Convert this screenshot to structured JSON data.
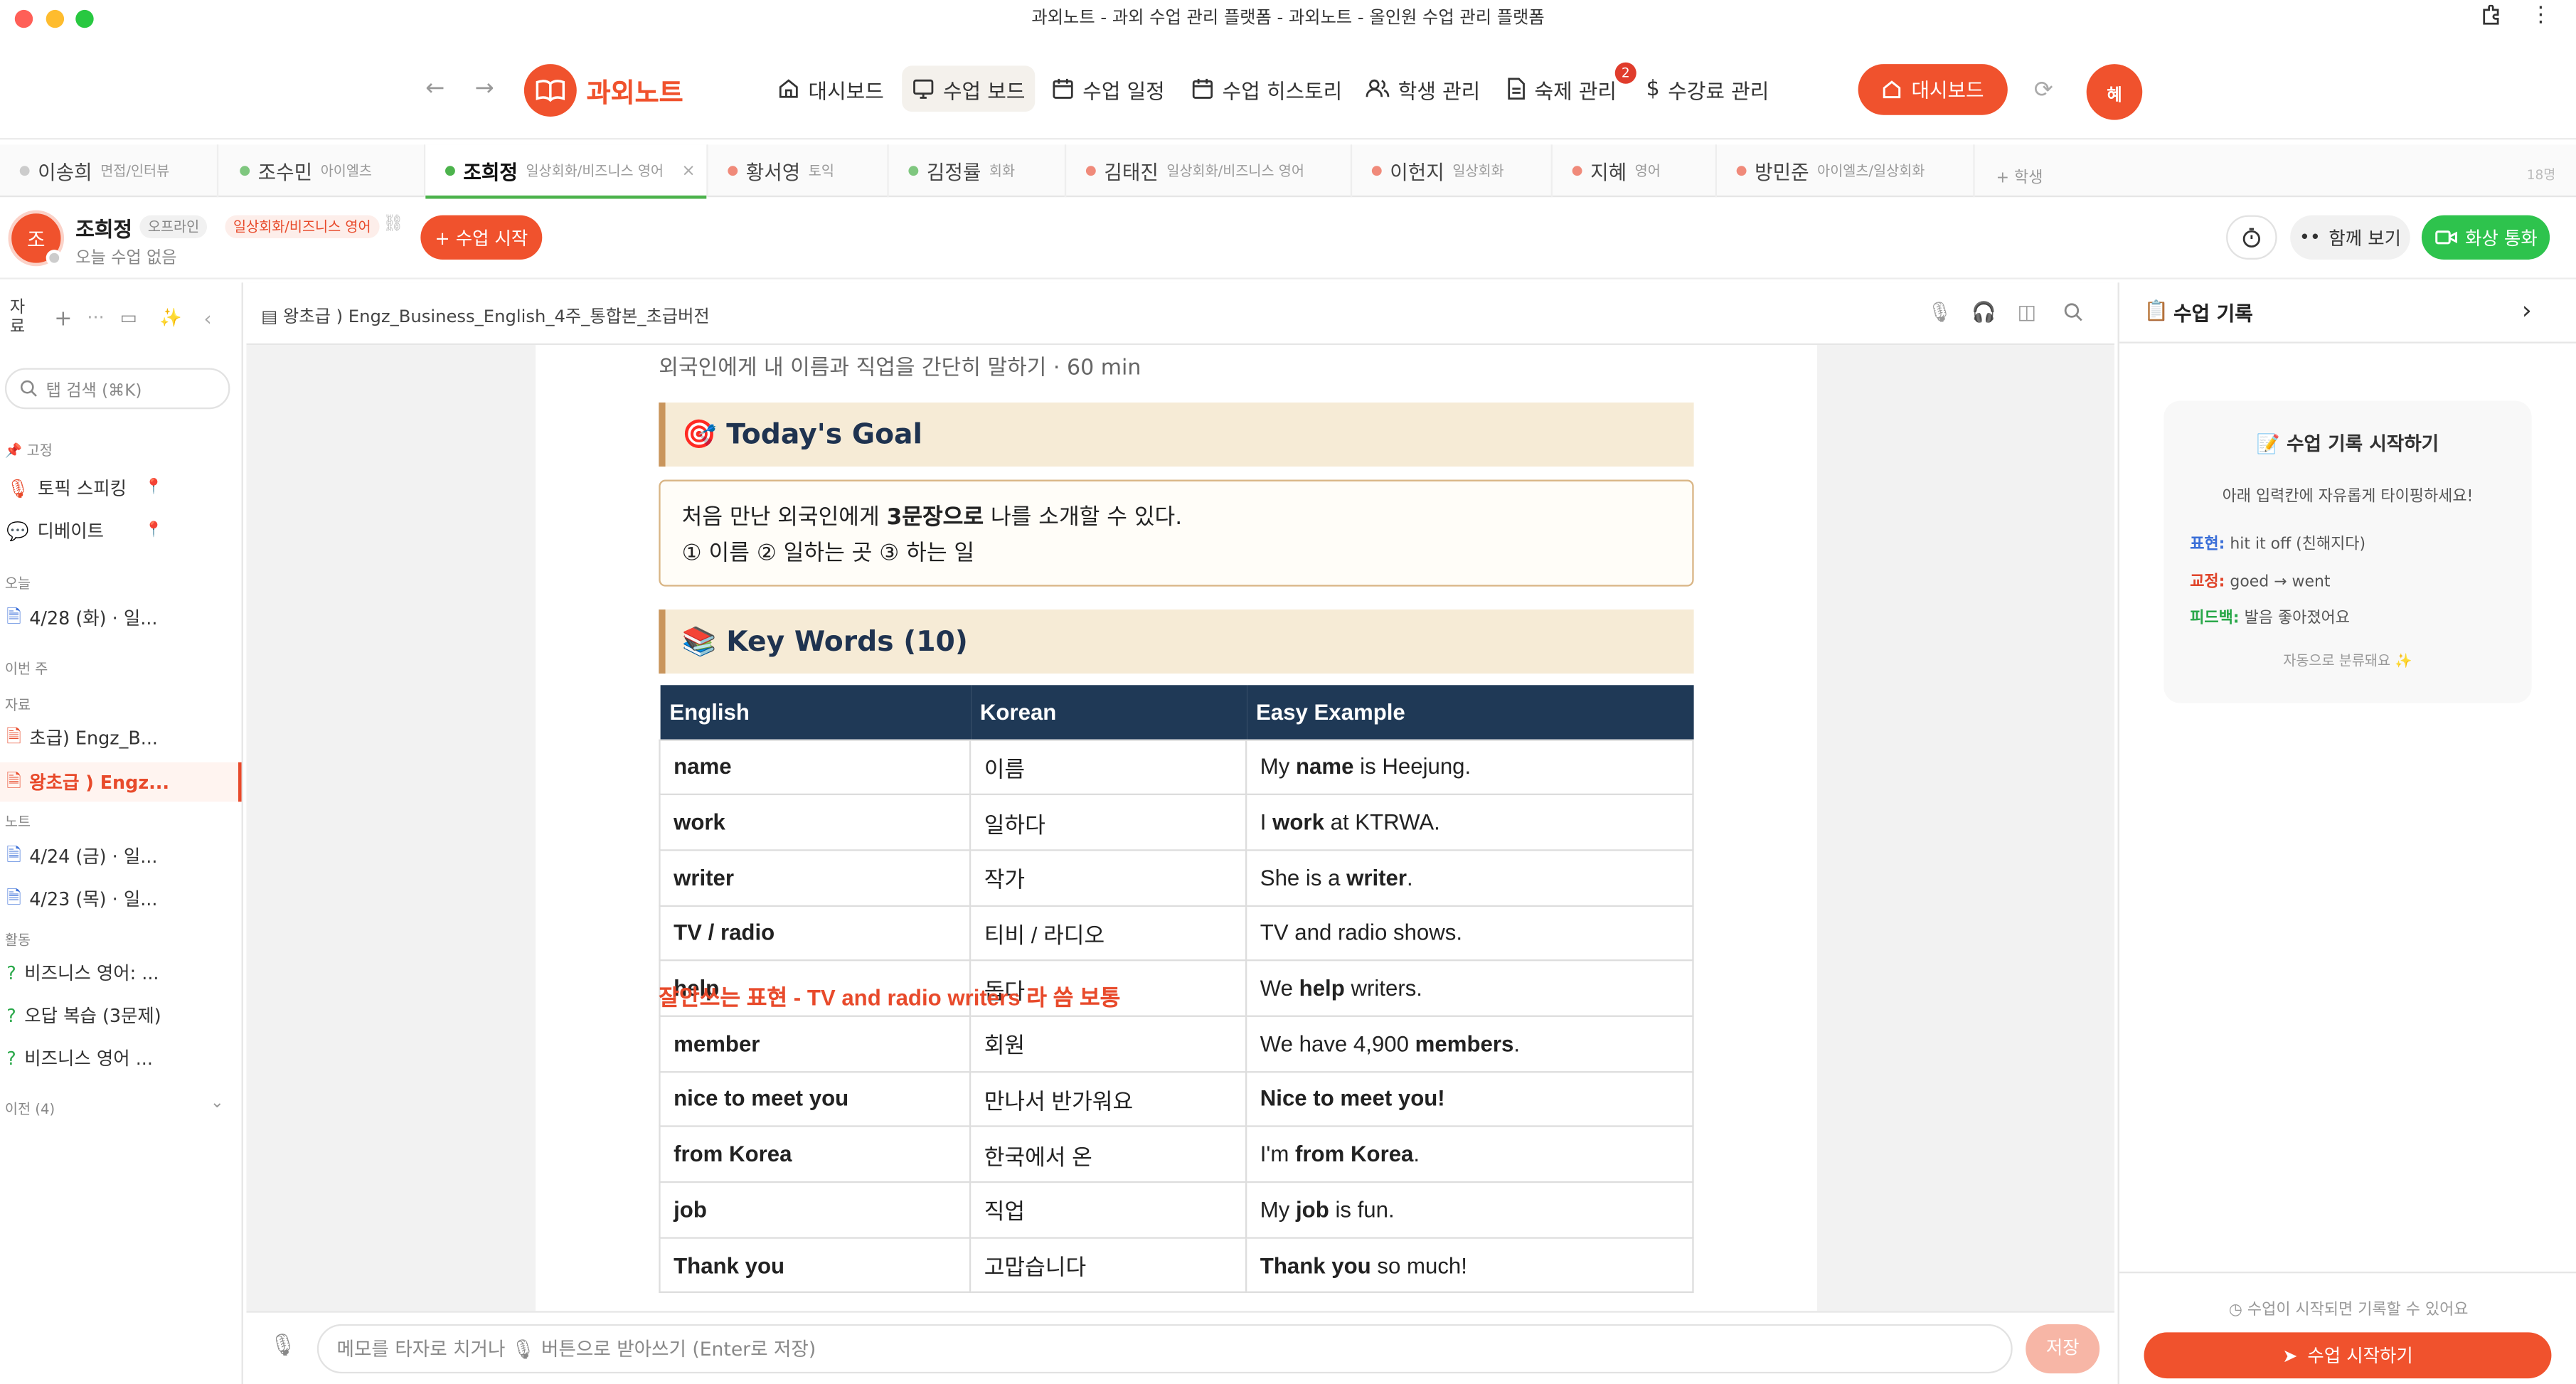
{
  "window": {
    "title": "과외노트 - 과외 수업 관리 플랫폼 - 과외노트 - 올인원 수업 관리 플랫폼"
  },
  "header": {
    "logo": "과외노트",
    "nav": [
      {
        "label": "대시보드",
        "icon": "home-icon"
      },
      {
        "label": "수업 보드",
        "icon": "monitor-icon"
      },
      {
        "label": "수업 일정",
        "icon": "calendar-icon"
      },
      {
        "label": "수업 히스토리",
        "icon": "calendar-icon"
      },
      {
        "label": "학생 관리",
        "icon": "users-icon"
      },
      {
        "label": "숙제 관리",
        "icon": "document-icon",
        "badge": "2"
      },
      {
        "label": "수강료 관리",
        "icon": "dollar-icon"
      }
    ],
    "dashboard_button": "대시보드",
    "avatar": "혜"
  },
  "student_tabs": [
    {
      "name": "이송희",
      "subject": "면접/인터뷰"
    },
    {
      "name": "조수민",
      "subject": "아이엘츠"
    },
    {
      "name": "조희정",
      "subject": "일상회화/비즈니스 영어"
    },
    {
      "name": "황서영",
      "subject": "토익"
    },
    {
      "name": "김정률",
      "subject": "회화"
    },
    {
      "name": "김태진",
      "subject": "일상회화/비즈니스 영어"
    },
    {
      "name": "이헌지",
      "subject": "일상회화"
    },
    {
      "name": "지혜",
      "subject": "영어"
    },
    {
      "name": "방민준",
      "subject": "아이엘츠/일상회화"
    }
  ],
  "add_student": "+ 학생",
  "tab_count": "18명",
  "student_bar": {
    "avatar": "조",
    "name": "조희정",
    "status": "오프라인",
    "subject": "일상회화/비즈니스 영어",
    "today": "오늘 수업 없음",
    "start_button": "+ 수업 시작",
    "watch_together": "함께 보기",
    "video_call": "화상 통화"
  },
  "sidebar": {
    "title": "자료",
    "search_placeholder": "탭 검색 (⌘K)",
    "pinned_label": "고정",
    "pinned": [
      "토픽 스피킹",
      "디베이트"
    ],
    "today_label": "오늘",
    "today": [
      "4/28 (화) · 일..."
    ],
    "week_label": "이번 주",
    "materials_label": "자료",
    "materials": [
      "초급) Engz_B...",
      "왕초급 ) Engz..."
    ],
    "notes_label": "노트",
    "notes": [
      "4/24 (금) · 일...",
      "4/23 (목) · 일..."
    ],
    "activity_label": "활동",
    "activities": [
      "비즈니스 영어: ...",
      "오답 복습 (3문제)",
      "비즈니스 영어 ..."
    ],
    "previous": "이전 (4)"
  },
  "document": {
    "filename": "왕초급 ) Engz_Business_English_4주_통합본_초급버전",
    "subtitle": "외국인에게 내 이름과 직업을 간단히 말하기 · 60 min",
    "goal_heading": "🎯 Today's Goal",
    "goal_line1_a": "처음 만난 외국인에게 ",
    "goal_line1_b": "3문장으로",
    "goal_line1_c": " 나를 소개할 수 있다.",
    "goal_line2": "① 이름 ② 일하는 곳 ③ 하는 일",
    "keywords_heading": "📚 Key Words (10)",
    "table_headers": [
      "English",
      "Korean",
      "Easy Example"
    ],
    "rows": [
      {
        "en": "name",
        "ko": "이름",
        "ex_a": "My ",
        "ex_b": "name",
        "ex_c": " is Heejung."
      },
      {
        "en": "work",
        "ko": "일하다",
        "ex_a": "I ",
        "ex_b": "work",
        "ex_c": " at KTRWA."
      },
      {
        "en": "writer",
        "ko": "작가",
        "ex_a": "She is a ",
        "ex_b": "writer",
        "ex_c": "."
      },
      {
        "en": "TV / radio",
        "ko": "티비 / 라디오",
        "ex_a": "TV and radio shows.",
        "ex_b": "",
        "ex_c": ""
      },
      {
        "en": "help",
        "ko": "돕다",
        "ex_a": "We ",
        "ex_b": "help",
        "ex_c": " writers."
      },
      {
        "en": "member",
        "ko": "회원",
        "ex_a": "We have 4,900 ",
        "ex_b": "members",
        "ex_c": "."
      },
      {
        "en": "nice to meet you",
        "ko": "만나서 반가워요",
        "ex_a": "",
        "ex_b": "Nice to meet you!",
        "ex_c": ""
      },
      {
        "en": "from Korea",
        "ko": "한국에서 온",
        "ex_a": "I'm ",
        "ex_b": "from Korea",
        "ex_c": "."
      },
      {
        "en": "job",
        "ko": "직업",
        "ex_a": "My ",
        "ex_b": "job",
        "ex_c": " is fun."
      },
      {
        "en": "Thank you",
        "ko": "고맙습니다",
        "ex_a": "",
        "ex_b": "Thank you",
        "ex_c": " so much!"
      }
    ],
    "annotation": "잘안쓰는 표현 - TV and radio writers 라 씀 보통"
  },
  "memo": {
    "placeholder": "메모를 타자로 치거나 🎙 버튼으로 받아쓰기 (Enter로 저장)",
    "save": "저장"
  },
  "right_panel": {
    "title": "수업 기록",
    "card_title": "📝 수업 기록 시작하기",
    "card_desc": "아래 입력칸에 자유롭게 타이핑하세요!",
    "examples": [
      {
        "label": "표현:",
        "text": "hit it off (친해지다)",
        "color": "#3b6fd8"
      },
      {
        "label": "교정:",
        "text": "goed → went",
        "color": "#e0462c"
      },
      {
        "label": "피드백:",
        "text": "발음 좋아졌어요",
        "color": "#2aa84a"
      }
    ],
    "auto": "자동으로 분류돼요 ✨",
    "hint": "수업이 시작되면 기록할 수 있어요",
    "start_button": "수업 시작하기"
  },
  "colors": {
    "accent": "#f0522d",
    "green": "#2ec34d",
    "navy": "#1f3956"
  }
}
